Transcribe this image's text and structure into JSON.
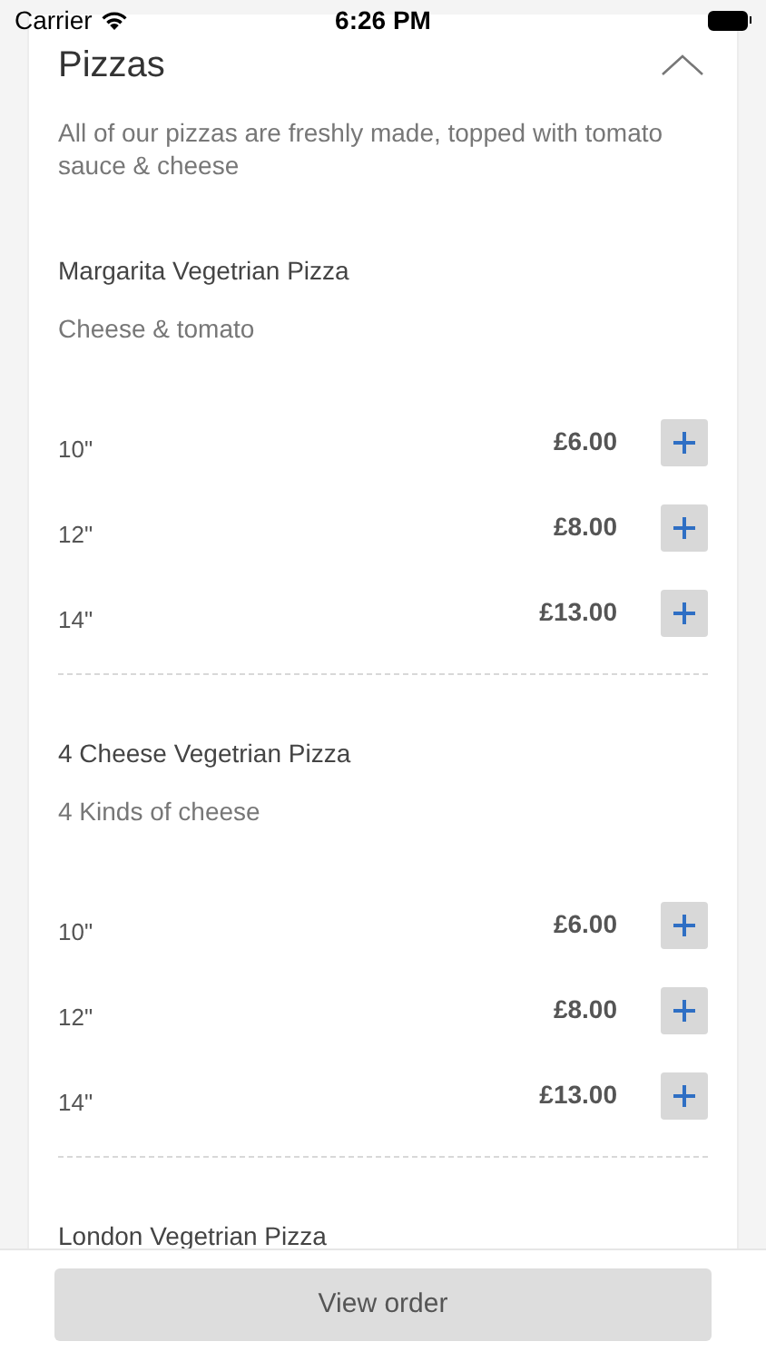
{
  "status_bar": {
    "carrier": "Carrier",
    "time": "6:26 PM"
  },
  "section": {
    "title": "Pizzas",
    "expanded": true,
    "description": "All of our pizzas are freshly made, topped with tomato sauce & cheese",
    "items": [
      {
        "name": "Margarita Vegetrian Pizza",
        "description": "Cheese & tomato",
        "sizes": [
          {
            "size": "10\"",
            "price": "£6.00"
          },
          {
            "size": "12\"",
            "price": "£8.00"
          },
          {
            "size": "14\"",
            "price": "£13.00"
          }
        ]
      },
      {
        "name": "4 Cheese Vegetrian Pizza",
        "description": "4 Kinds of cheese",
        "sizes": [
          {
            "size": "10\"",
            "price": "£6.00"
          },
          {
            "size": "12\"",
            "price": "£8.00"
          },
          {
            "size": "14\"",
            "price": "£13.00"
          }
        ]
      },
      {
        "name": "London Vegetrian Pizza"
      }
    ]
  },
  "footer": {
    "button": "View order"
  }
}
